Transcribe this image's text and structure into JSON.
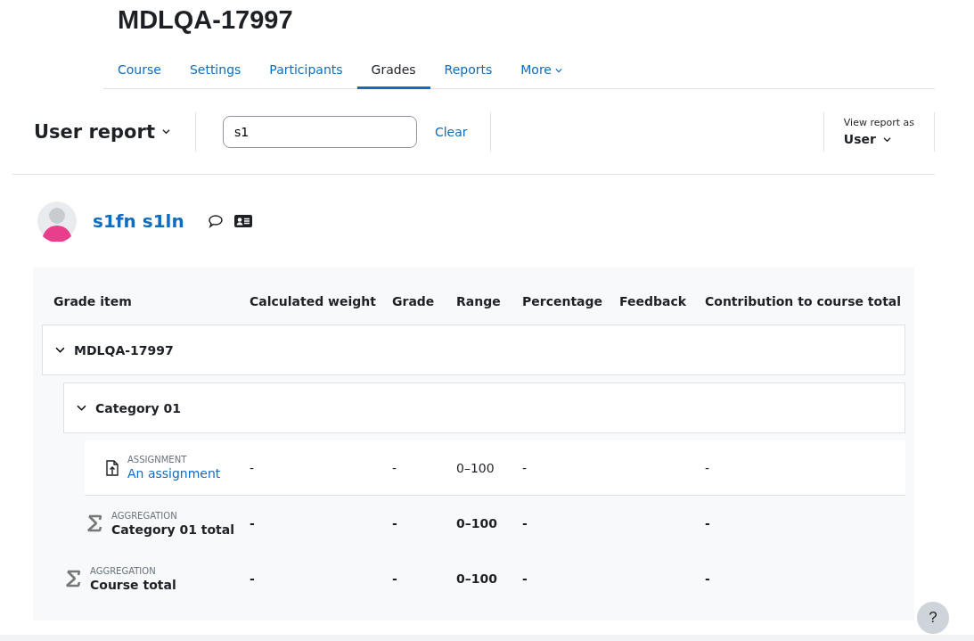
{
  "course_title": "MDLQA-17997",
  "tabs": [
    {
      "label": "Course",
      "selected": false,
      "kind": "link"
    },
    {
      "label": "Settings",
      "selected": false,
      "kind": "link"
    },
    {
      "label": "Participants",
      "selected": false,
      "kind": "link"
    },
    {
      "label": "Grades",
      "selected": true,
      "kind": "link"
    },
    {
      "label": "Reports",
      "selected": false,
      "kind": "link"
    },
    {
      "label": "More",
      "selected": false,
      "kind": "menu"
    }
  ],
  "report_selector": {
    "label": "User report"
  },
  "search": {
    "value": "s1",
    "clear": "Clear"
  },
  "view_as": {
    "caption": "View report as",
    "value": "User"
  },
  "user": {
    "name": "s1fn s1ln"
  },
  "table": {
    "columns": [
      "Grade item",
      "Calculated weight",
      "Grade",
      "Range",
      "Percentage",
      "Feedback",
      "Contribution to course total"
    ],
    "rows": [
      {
        "kind": "category",
        "name": "MDLQA-17997",
        "expanded": true,
        "children": [
          {
            "kind": "category",
            "name": "Category 01",
            "expanded": true,
            "children": [
              {
                "kind": "item",
                "type_label": "ASSIGNMENT",
                "name": "An assignment",
                "cells": [
                  "-",
                  "-",
                  "0–100",
                  "-",
                  "",
                  "-"
                ]
              },
              {
                "kind": "total",
                "type_label": "AGGREGATION",
                "name": "Category 01 total",
                "cells": [
                  "-",
                  "-",
                  "0–100",
                  "-",
                  "",
                  "-"
                ]
              }
            ]
          },
          {
            "kind": "total",
            "type_label": "AGGREGATION",
            "name": "Course total",
            "cells": [
              "-",
              "-",
              "0–100",
              "-",
              "",
              "-"
            ]
          }
        ]
      }
    ]
  },
  "help_button": {
    "label": "?"
  }
}
